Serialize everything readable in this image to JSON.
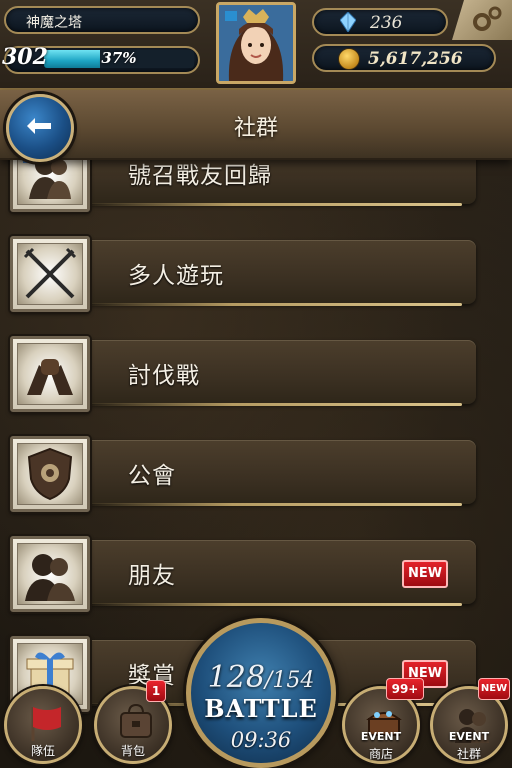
{
  "status": {
    "stage_name": "神魔之塔",
    "level": "302",
    "xp_percent_label": "37%",
    "xp_fraction": 0.37,
    "gems": "236",
    "gold": "5,617,256"
  },
  "header": {
    "title": "社群"
  },
  "menu": {
    "items": [
      {
        "label": "號召戰友回歸",
        "icon": "recall-friends-icon",
        "new": ""
      },
      {
        "label": "多人遊玩",
        "icon": "crossed-swords-icon",
        "new": ""
      },
      {
        "label": "討伐戰",
        "icon": "clasped-arms-icon",
        "new": ""
      },
      {
        "label": "公會",
        "icon": "guild-shield-icon",
        "new": ""
      },
      {
        "label": "朋友",
        "icon": "friends-silhouette-icon",
        "new": "NEW"
      },
      {
        "label": "獎賞",
        "icon": "gift-box-icon",
        "new": "NEW"
      }
    ]
  },
  "bottom_nav": {
    "team_label": "隊伍",
    "bag_label": "背包",
    "bag_badge": "1",
    "shop_event": "EVENT",
    "shop_label": "商店",
    "shop_badge": "99+",
    "social_event": "EVENT",
    "social_label": "社群",
    "social_badge": "NEW"
  },
  "battle": {
    "stamina_current": "128",
    "stamina_max": "/154",
    "label": "BATTLE",
    "timer": "09:36"
  },
  "colors": {
    "accent_gold": "#c9a866",
    "badge_red": "#e2222a",
    "battle_blue": "#1e4f7b"
  }
}
